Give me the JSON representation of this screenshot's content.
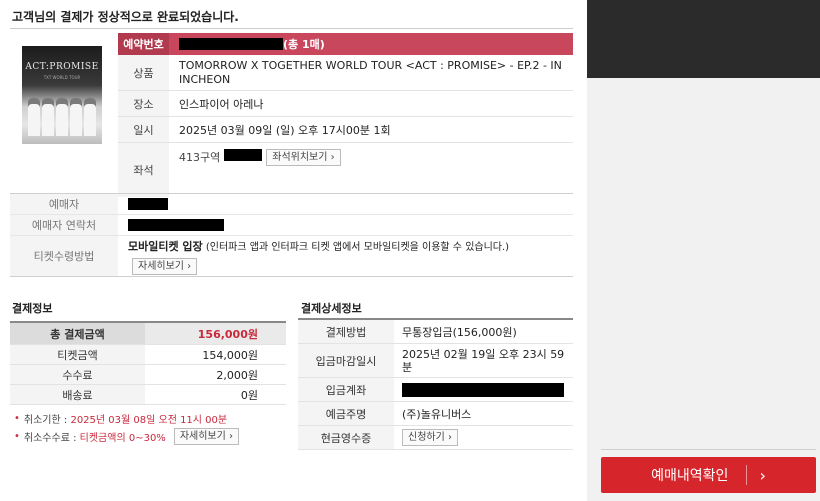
{
  "page": {
    "title": "고객님의 결제가 정상적으로 완료되었습니다."
  },
  "poster": {
    "title": "ACT:PROMISE",
    "subtitle": "TXT WORLD TOUR"
  },
  "reservation": {
    "number_label": "예약번호",
    "count_text": "(총 1매)",
    "product_label": "상품",
    "product": "TOMORROW X TOGETHER WORLD TOUR <ACT : PROMISE> - EP.2 - IN INCHEON",
    "venue_label": "장소",
    "venue": "인스파이어 아레나",
    "datetime_label": "일시",
    "datetime": "2025년 03월 09일 (일) 오후 17시00분 1회",
    "seat_label": "좌석",
    "seat_section": "413구역",
    "seat_button": "좌석위치보기 ›"
  },
  "booker": {
    "name_label": "예매자",
    "contact_label": "예매자 연락처",
    "method_label": "티켓수령방법",
    "method": "모바일티켓 입장",
    "method_note": "(인터파크 앱과 인터파크 티켓 앱에서 모바일티켓을 이용할 수 있습니다.)",
    "detail_button": "자세히보기 ›"
  },
  "payment": {
    "section_title": "결제정보",
    "total_label": "총 결제금액",
    "total": "156,000원",
    "ticket_label": "티켓금액",
    "ticket": "154,000원",
    "fee_label": "수수료",
    "fee": "2,000원",
    "shipping_label": "배송료",
    "shipping": "0원"
  },
  "notes": {
    "cancel_deadline_label": "취소기한 :",
    "cancel_deadline": "2025년 03월 08일 오전 11시 00분",
    "cancel_fee_label": "취소수수료 :",
    "cancel_fee": "티켓금액의 0~30%",
    "cancel_fee_button": "자세히보기 ›"
  },
  "payment_detail": {
    "section_title": "결제상세정보",
    "method_label": "결제방법",
    "method": "무통장입금(156,000원)",
    "deadline_label": "입금마감일시",
    "deadline": "2025년 02월 19일 오후 23시 59분",
    "account_label": "입금계좌",
    "depositor_label": "예금주명",
    "depositor": "(주)놀유니버스",
    "receipt_label": "현금영수증",
    "receipt_button": "신청하기 ›"
  },
  "side": {
    "confirm_button": "예매내역확인"
  },
  "colors": {
    "accent": "#c8475c",
    "button": "#d7262b",
    "price": "#c8293b"
  }
}
